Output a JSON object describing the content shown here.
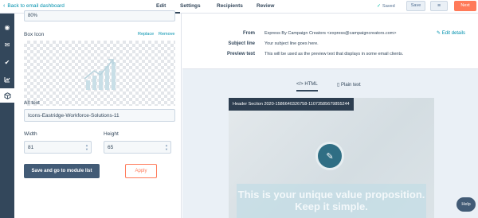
{
  "topbar": {
    "back_label": "Back to email dashboard",
    "tabs": [
      {
        "label": "Edit",
        "active": true
      },
      {
        "label": "Settings",
        "active": false
      },
      {
        "label": "Recipients",
        "active": false
      },
      {
        "label": "Review",
        "active": false
      }
    ],
    "saved_label": "Saved",
    "save_label": "Save",
    "menu_label": "≡",
    "next_label": "Next"
  },
  "left_panel": {
    "top_value": "80%",
    "box_icon_label": "Box Icon",
    "replace_label": "Replace",
    "remove_label": "Remove",
    "alt_label": "Alt text",
    "alt_value": "Icons-Eastridge-Workforce-Solutions-11",
    "width_label": "Width",
    "width_value": "81",
    "height_label": "Height",
    "height_value": "65",
    "save_module_label": "Save and go to module list",
    "apply_label": "Apply"
  },
  "email_header": {
    "from_label": "From",
    "from_value": "Express By Campaign Creators <express@campaigncreators.com>",
    "subject_label": "Subject line",
    "subject_value": "Your subject line goes here.",
    "preview_label": "Preview text",
    "preview_value": "This will be used as the preview text that displays in some email clients.",
    "edit_details_label": "Edit details"
  },
  "preview_tabs": {
    "html_label": "HTML",
    "plain_label": "Plain text"
  },
  "email_preview": {
    "section_label": "Header Section 2020-1586640326758-11073585679855244",
    "value_text": "This is your unique value proposition. Keep it simple."
  },
  "help_label": "Help",
  "colors": {
    "accent": "#0091ae",
    "primary_dark": "#33475b",
    "next_orange": "#ff7a59"
  }
}
